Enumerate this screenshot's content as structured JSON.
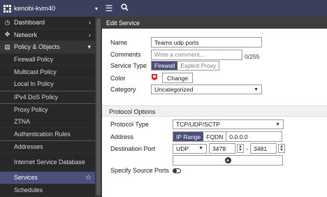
{
  "topbar": {
    "device_name": "kenobi-kvm40"
  },
  "sidebar": {
    "top_items": [
      {
        "label": "Dashboard",
        "icon": "dashboard-icon"
      },
      {
        "label": "Network",
        "icon": "network-icon"
      },
      {
        "label": "Policy & Objects",
        "icon": "policy-icon"
      }
    ],
    "sub_items": [
      "Firewall Policy",
      "Multicast Policy",
      "Local In Policy",
      "IPv4 DoS Policy",
      "Proxy Policy",
      "ZTNA",
      "Authentication Rules",
      "Addresses",
      "Internet Service Database",
      "Services",
      "Schedules"
    ]
  },
  "form": {
    "title": "Edit Service",
    "name_label": "Name",
    "name_value": "Teams udp ports",
    "comments_label": "Comments",
    "comments_placeholder": "Write a comment...",
    "comments_counter": "0/255",
    "service_type_label": "Service Type",
    "service_type_options": [
      "Firewall",
      "Explicit Proxy"
    ],
    "color_label": "Color",
    "color_change": "Change",
    "category_label": "Category",
    "category_value": "Uncategorized",
    "protocol_section": "Protocol Options",
    "protocol_type_label": "Protocol Type",
    "protocol_type_value": "TCP/UDP/SCTP",
    "address_label": "Address",
    "address_modes": [
      "IP Range",
      "FQDN"
    ],
    "address_value": "0.0.0.0",
    "dest_port_label": "Destination Port",
    "dest_protocol": "UDP",
    "port_low": "3478",
    "port_dash": "-",
    "port_high": "3481",
    "source_ports_label": "Specify Source Ports"
  },
  "colors": {
    "accent": "#4b4f79",
    "topbar": "#3b3f5c",
    "sidebar": "#282828",
    "fortinet_red": "#d42a2a"
  }
}
